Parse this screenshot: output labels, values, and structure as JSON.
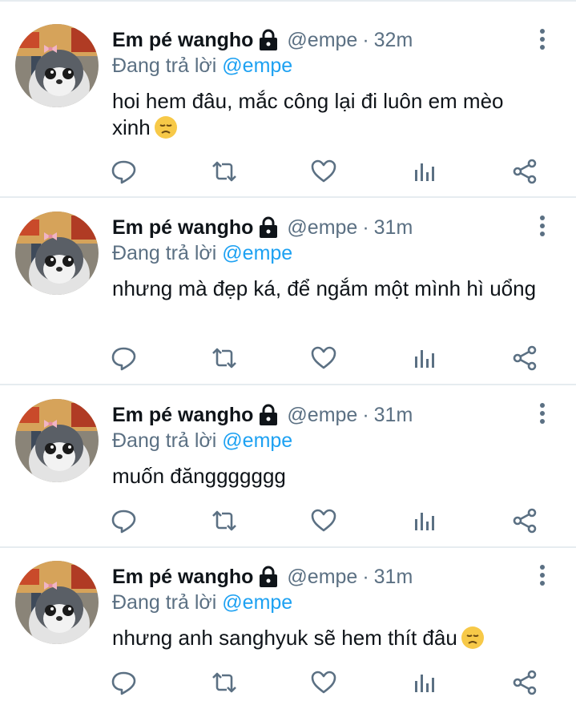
{
  "tweets": [
    {
      "name": "Em pé wangho",
      "handle": "@empe",
      "separator": "·",
      "time": "32m",
      "reply_prefix": "Đang trả lời",
      "reply_mention": "@empe",
      "text": "hoi hem đâu, mắc công lại đi luôn em mèo xinh",
      "emoji": "disappointed-face-icon"
    },
    {
      "name": "Em pé wangho",
      "handle": "@empe",
      "separator": "·",
      "time": "31m",
      "reply_prefix": "Đang trả lời",
      "reply_mention": "@empe",
      "text": "nhưng mà đẹp ká, để ngắm một mình hì uổng",
      "emoji": ""
    },
    {
      "name": "Em pé wangho",
      "handle": "@empe",
      "separator": "·",
      "time": "31m",
      "reply_prefix": "Đang trả lời",
      "reply_mention": "@empe",
      "text": "muốn đănggggggg",
      "emoji": ""
    },
    {
      "name": "Em pé wangho",
      "handle": "@empe",
      "separator": "·",
      "time": "31m",
      "reply_prefix": "Đang trả lời",
      "reply_mention": "@empe",
      "text": "nhưng anh sanghyuk sẽ hem thít đâu",
      "emoji": "disappointed-face-icon"
    }
  ],
  "icons": {
    "lock": "lock-icon",
    "more": "more-vertical-icon",
    "actions": [
      "reply-icon",
      "retweet-icon",
      "like-icon",
      "analytics-icon",
      "share-icon"
    ]
  },
  "colors": {
    "text": "#0f1419",
    "secondary": "#5b7083",
    "accent": "#1da1f2",
    "divider": "#e6ecf0",
    "emoji": "#f7c948"
  }
}
